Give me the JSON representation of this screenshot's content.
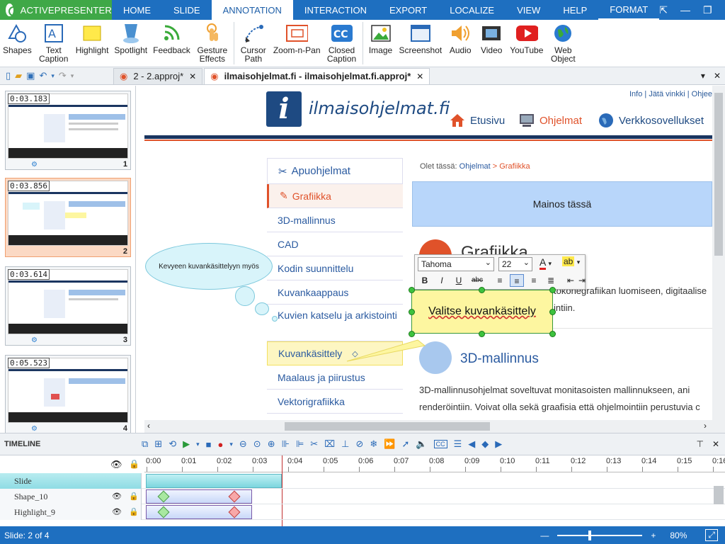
{
  "menubar": {
    "app": "ACTIVEPRESENTER",
    "tabs": [
      "HOME",
      "SLIDE",
      "ANNOTATION",
      "INTERACTION",
      "EXPORT",
      "LOCALIZE",
      "VIEW",
      "HELP",
      "FORMAT"
    ]
  },
  "ribbon": {
    "shapes": "Shapes",
    "text_caption": "Text Caption",
    "highlight": "Highlight",
    "spotlight": "Spotlight",
    "feedback": "Feedback",
    "gesture": "Gesture Effects",
    "cursor": "Cursor Path",
    "zoom": "Zoom-n-Pan",
    "closed": "Closed Caption",
    "image": "Image",
    "screenshot": "Screenshot",
    "audio": "Audio",
    "video": "Video",
    "youtube": "YouTube",
    "web": "Web Object"
  },
  "doctabs": {
    "tab1": "2 - 2.approj*",
    "tab2": "ilmaisohjelmat.fi - ilmaisohjelmat.fi.approj*"
  },
  "slides": [
    {
      "time": "0:03.183",
      "num": "1"
    },
    {
      "time": "0:03.856",
      "num": "2"
    },
    {
      "time": "0:03.614",
      "num": "3"
    },
    {
      "time": "0:05.523",
      "num": "4"
    }
  ],
  "site": {
    "logo": "ilmaisohjelmat.fi",
    "toplinks": "Info  |  Jätä vinkki  |  Ohjee",
    "nav": [
      "Etusivu",
      "Ohjelmat",
      "Verkkosovellukset"
    ],
    "menu": [
      "Apuohjelmat",
      "Grafiikka",
      "3D-mallinnus",
      "CAD",
      "Kodin suunnittelu",
      "Kuvankaappaus",
      "Kuvien katselu ja arkistointi",
      "Kuvankäsittely",
      "Maalaus ja piirustus",
      "Vektorigrafiikka"
    ],
    "breadcrumb_label": "Olet tässä:",
    "breadcrumb_1": "Ohjelmat",
    "breadcrumb_sep": ">",
    "breadcrumb_2": "Grafiikka",
    "ad": "Mainos tässä",
    "grafiikka_heading": "Grafiikka",
    "grafiikka_text_1": "tokonegrafiikan luomiseen, digitaalise",
    "grafiikka_text_2": "intiin.",
    "section_title": "3D-mallinnus",
    "section_text_1": "3D-mallinnusohjelmat soveltuvat monitasoisten mallinnukseen, ani",
    "section_text_2": "renderöintiin. Voivat olla sekä graafisia että ohjelmointiin perustuvia c"
  },
  "annotation": {
    "cloud_text": "Kevyeen kuvankäsittelyyn myös",
    "caption_text": "Valitse kuvankäsittely",
    "font": "Tahoma",
    "size": "22"
  },
  "timeline": {
    "title": "TIMELINE",
    "ticks": [
      "0:00",
      "0:01",
      "0:02",
      "0:03",
      "0:04",
      "0:05",
      "0:06",
      "0:07",
      "0:08",
      "0:09",
      "0:10",
      "0:11",
      "0:12",
      "0:13",
      "0:14",
      "0:15",
      "0:16"
    ],
    "rows": [
      "Slide",
      "Shape_10",
      "Highlight_9"
    ]
  },
  "status": {
    "slide": "Slide: 2 of 4",
    "zoom": "80%"
  },
  "colors": {
    "accent": "#1e6fc0",
    "app_green": "#3fa847",
    "site_orange": "#e0522a"
  }
}
